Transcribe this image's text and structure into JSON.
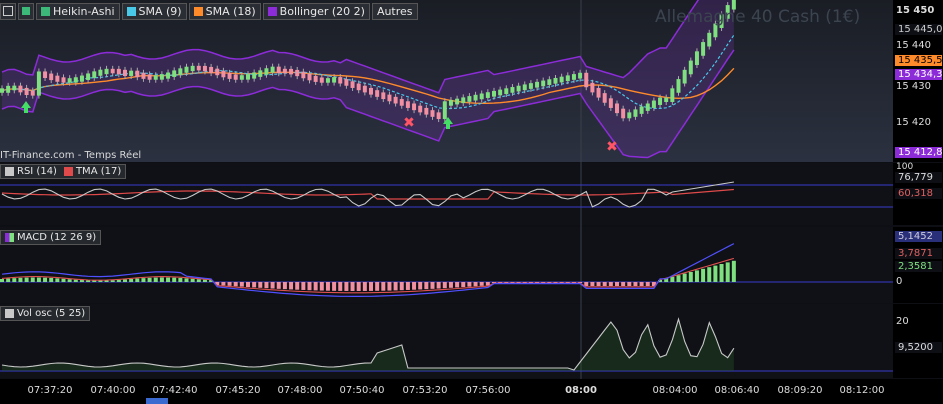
{
  "toolbar": {
    "heikin_label": "Heikin-Ashi",
    "sma9_label": "SMA (9)",
    "sma18_label": "SMA (18)",
    "bollinger_label": "Bollinger (20 2)",
    "autres_label": "Autres"
  },
  "colors": {
    "heikin": "#3cb878",
    "sma9": "#49c8e8",
    "sma18": "#ff8a2a",
    "bollinger": "#8c2cd9",
    "rsi": "#c8c8c8",
    "tma": "#e04a4a",
    "macd": "#8c2cd9",
    "vol": "#c8c8c8",
    "up": "#7ee07e",
    "down": "#f090a0"
  },
  "watermark": "Allemagne 40 Cash (1€)",
  "source": "IT-Finance.com - Temps Réel",
  "price_axis": {
    "ticks": [
      "15 450",
      "15 440",
      "15 430",
      "15 420"
    ],
    "tag_sma9": "15 445,0",
    "tag_sma18": "15 435,5",
    "tag_bb_upper": "15 434,3",
    "tag_bb_lower": "15 412,8"
  },
  "rsi_pane": {
    "rsi_label": "RSI (14)",
    "tma_label": "TMA (17)",
    "tag_rsi": "76,779",
    "tag_tma": "60,318",
    "tick_top": "100"
  },
  "macd_pane": {
    "label": "MACD (12 26 9)",
    "tag_macd": "5,1452",
    "tag_signal": "3,7871",
    "tag_hist": "2,3581",
    "zero": "0"
  },
  "vol_pane": {
    "label": "Vol osc (5 25)",
    "tick_20": "20",
    "tag_value": "9,5200"
  },
  "time_axis": [
    "07:37:20",
    "07:40:00",
    "07:42:40",
    "07:45:20",
    "07:48:00",
    "07:50:40",
    "07:53:20",
    "07:56:00",
    "08:00",
    "08:04:00",
    "08:06:40",
    "08:09:20",
    "08:12:00"
  ]
}
